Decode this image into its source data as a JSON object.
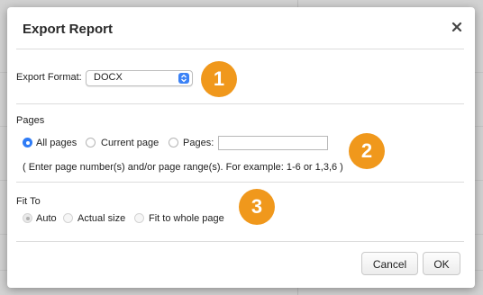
{
  "dialog": {
    "title": "Export Report",
    "close_icon": "close-x-icon"
  },
  "export_format": {
    "label": "Export Format:",
    "selected": "DOCX"
  },
  "pages": {
    "section_label": "Pages",
    "options": {
      "all": "All pages",
      "current": "Current page",
      "pages": "Pages:"
    },
    "selected": "All pages",
    "pages_input_value": "",
    "hint": "( Enter page number(s) and/or page range(s). For example: 1-6 or 1,3,6 )"
  },
  "fit_to": {
    "section_label": "Fit To",
    "options": {
      "auto": "Auto",
      "actual": "Actual size",
      "whole": "Fit to whole page"
    },
    "selected": "Auto"
  },
  "badges": [
    "1",
    "2",
    "3"
  ],
  "buttons": {
    "cancel": "Cancel",
    "ok": "OK"
  },
  "colors": {
    "accent": "#2f7cf6",
    "badge": "#f0981c"
  }
}
